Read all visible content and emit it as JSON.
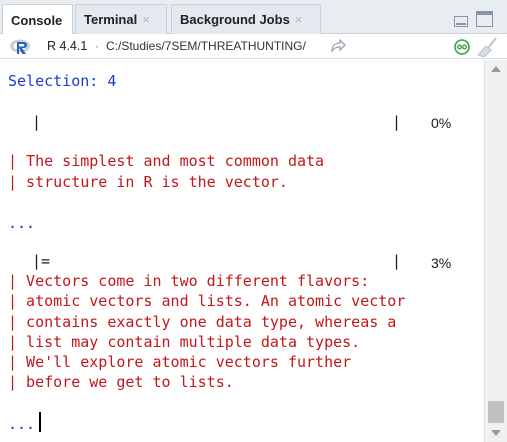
{
  "tabs": [
    {
      "label": "Console",
      "active": true,
      "closable": false
    },
    {
      "label": "Terminal",
      "active": false,
      "closable": true
    },
    {
      "label": "Background Jobs",
      "active": false,
      "closable": true
    }
  ],
  "close_glyph": "×",
  "pathbar": {
    "r_version": "R 4.4.1",
    "separator": "·",
    "path": "C:/Studies/7SEM/THREATHUNTING/",
    "icons": [
      "r-logo-icon",
      "go-to-directory-icon",
      "background-job-icon",
      "broom-clear-icon"
    ]
  },
  "console": {
    "selection": "Selection: 4",
    "progress_1": {
      "bar": "|",
      "end": "|",
      "percent_label": "0%",
      "percent": 0
    },
    "message_1": [
      "| The simplest and most common data",
      "| structure in R is the vector."
    ],
    "continue_1": "...",
    "progress_2": {
      "bar": "|=",
      "end": "|",
      "percent_label": "3%",
      "percent": 3
    },
    "message_2": [
      "| Vectors come in two different flavors:",
      "| atomic vectors and lists. An atomic vector",
      "| contains exactly one data type, whereas a",
      "| list may contain multiple data types.",
      "| We'll explore atomic vectors further",
      "| before we get to lists."
    ],
    "continue_2": "..."
  },
  "colors": {
    "prompt_blue": "#1a3ccc",
    "message_red": "#c4161c",
    "tabbar_bg": "#e8edf2"
  }
}
